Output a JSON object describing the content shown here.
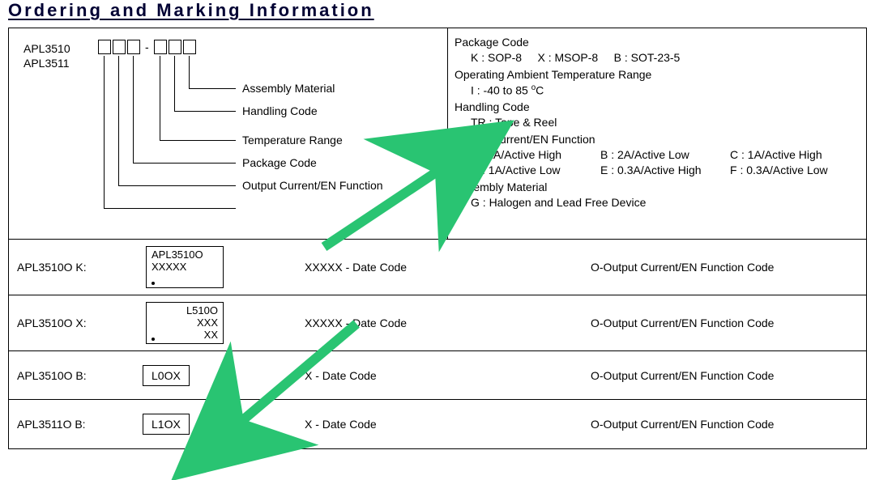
{
  "title": "Ordering and Marking Information",
  "diagram": {
    "part_numbers": [
      "APL3510",
      "APL3511"
    ],
    "box_pattern": "□□□-□□□",
    "labels": {
      "assembly_material": "Assembly Material",
      "handling_code": "Handling Code",
      "temperature_range": "Temperature  Range",
      "package_code": "Package Code",
      "output_current_en": "Output Current/EN Function"
    }
  },
  "codes": {
    "package_code": {
      "header": "Package Code",
      "items": [
        {
          "code": "K",
          "desc": "SOP-8"
        },
        {
          "code": "X",
          "desc": "MSOP-8"
        },
        {
          "code": "B",
          "desc": "SOT-23-5"
        }
      ]
    },
    "temperature": {
      "header": "Operating Ambient Temperature Range",
      "items": [
        {
          "code": "I",
          "desc": "-40 to 85 °C"
        }
      ]
    },
    "handling": {
      "header": "Handling Code",
      "items": [
        {
          "code": "TR",
          "desc": "Tape & Reel"
        }
      ]
    },
    "output": {
      "header": "Output Current/EN Function",
      "items": [
        {
          "code": "A",
          "desc": "2A/Active High"
        },
        {
          "code": "B",
          "desc": "2A/Active Low"
        },
        {
          "code": "C",
          "desc": "1A/Active High"
        },
        {
          "code": "D",
          "desc": "1A/Active Low"
        },
        {
          "code": "E",
          "desc": "0.3A/Active High"
        },
        {
          "code": "F",
          "desc": "0.3A/Active Low"
        }
      ]
    },
    "assembly": {
      "header": "Assembly Material",
      "items": [
        {
          "code": "G",
          "desc": "Halogen and Lead Free Device"
        }
      ]
    }
  },
  "markings": [
    {
      "part": "APL3510O K:",
      "chip": [
        "APL3510O",
        "XXXXX"
      ],
      "dot": true,
      "date": "XXXXX - Date Code",
      "func": "O-Output Current/EN Function Code",
      "tall": true
    },
    {
      "part": "APL3510O X:",
      "chip": [
        "L510O",
        "XXX"
      ],
      "dot": true,
      "rxx": "XX",
      "date": "XXXXX - Date Code",
      "func": "O-Output Current/EN Function Code",
      "tall": true,
      "ralign": true
    },
    {
      "part": "APL3510O B:",
      "chip": [
        "L0OX"
      ],
      "date": "X - Date Code",
      "func": "O-Output Current/EN Function Code"
    },
    {
      "part": "APL3511O B:",
      "chip": [
        "L1OX"
      ],
      "date": "X - Date Code",
      "func": "O-Output Current/EN Function Code"
    }
  ]
}
